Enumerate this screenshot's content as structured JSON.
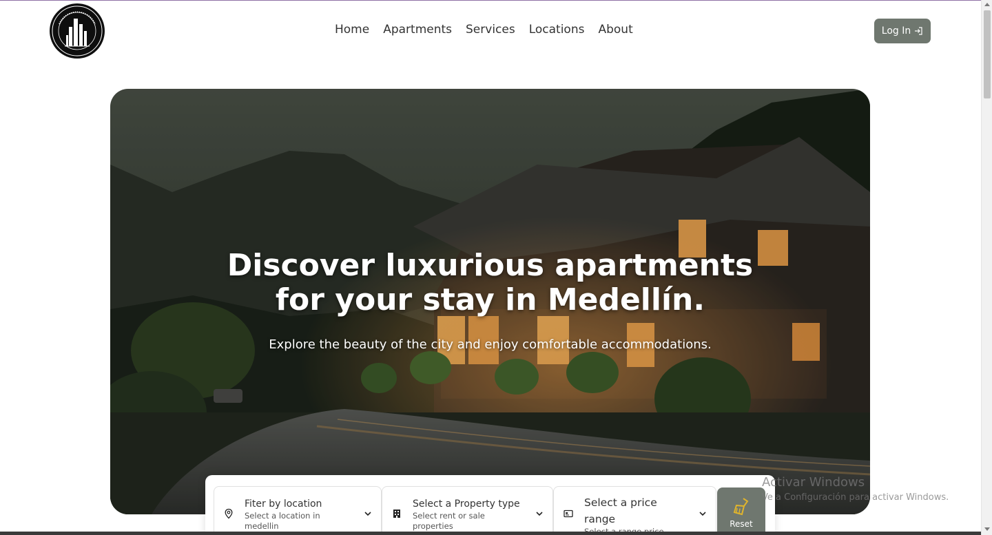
{
  "brand": {
    "logo_text": "FURNISHED APARTMENT MEDELLIN"
  },
  "nav": {
    "items": [
      {
        "label": "Home"
      },
      {
        "label": "Apartments"
      },
      {
        "label": "Services"
      },
      {
        "label": "Locations"
      },
      {
        "label": "About"
      }
    ],
    "login_label": "Log In",
    "login_icon": "login-arrow-icon"
  },
  "hero": {
    "title_line1": "Discover luxurious apartments",
    "title_line2": "for your stay in Medellín.",
    "subtitle": "Explore the beauty of the city and enjoy comfortable accommodations."
  },
  "search": {
    "location": {
      "title": "Fiter by location",
      "subtitle": "Select a location in medellin",
      "icon": "map-pin-icon"
    },
    "property_type": {
      "title": "Select a Property type",
      "subtitle": "Select rent or sale properties",
      "icon": "building-icon"
    },
    "price": {
      "title": "Select a price range",
      "subtitle": "Select a range price",
      "icon": "price-tag-icon"
    },
    "reset_label": "Reset",
    "reset_icon": "broom-icon"
  },
  "os_watermark": {
    "title": "Activar Windows",
    "subtitle": "Ve a Configuración para activar Windows."
  },
  "colors": {
    "accent": "#6f776f",
    "text": "#333333",
    "hero_text": "#ffffff",
    "reset_icon": "#e0b42c"
  }
}
